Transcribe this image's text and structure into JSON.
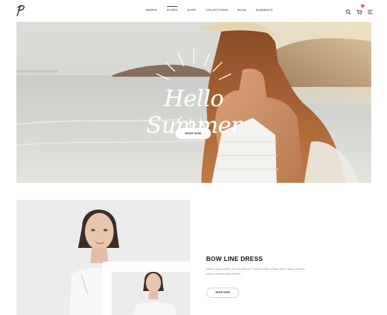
{
  "header": {
    "nav": [
      "DEMOS",
      "PAGES",
      "SHOP",
      "COLLECTIONS",
      "BLOG",
      "ELEMENTS"
    ],
    "active_nav": "PAGES",
    "cart_count": "0"
  },
  "hero": {
    "title": "Hello Summer",
    "button_label": "SHOP NOW"
  },
  "product": {
    "title": "BOW LINE DRESS",
    "description": "Nulla in lacinia tortor, ac venenatis mi. Praesent vitae sodales tortor. Mauris pretium, massa varius feugiat porttitor.",
    "button_label": "SHOP NOW"
  }
}
